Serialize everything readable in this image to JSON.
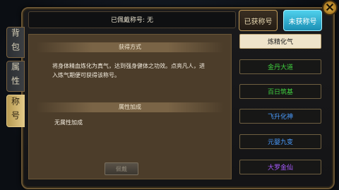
{
  "side_tabs": [
    {
      "label": "背包"
    },
    {
      "label": "属性"
    },
    {
      "label": "称号"
    }
  ],
  "title_bar": {
    "text": "已佩戴称号: 无"
  },
  "top_tabs": {
    "obtained": "已获称号",
    "not_obtained": "未获称号"
  },
  "sections": [
    {
      "header": "获得方式",
      "text": "将身体精血炼化为真气，达到强身健体之功效。点亮凡人，进入炼气期便可获得该称号。"
    },
    {
      "header": "属性加成",
      "text": "无属性加成"
    }
  ],
  "equip_button": "佩戴",
  "titles": [
    {
      "label": "炼精化气",
      "color": "#1a1a1a"
    },
    {
      "label": "金丹大道",
      "color": "#3fd03f"
    },
    {
      "label": "百日筑基",
      "color": "#3fd03f"
    },
    {
      "label": "飞升化神",
      "color": "#4a9cff"
    },
    {
      "label": "元婴九变",
      "color": "#4a9cff"
    },
    {
      "label": "大罗金仙",
      "color": "#a85aff"
    }
  ],
  "colors": {
    "accent_tab": "#2aa8d0",
    "frame": "#6a5533"
  }
}
